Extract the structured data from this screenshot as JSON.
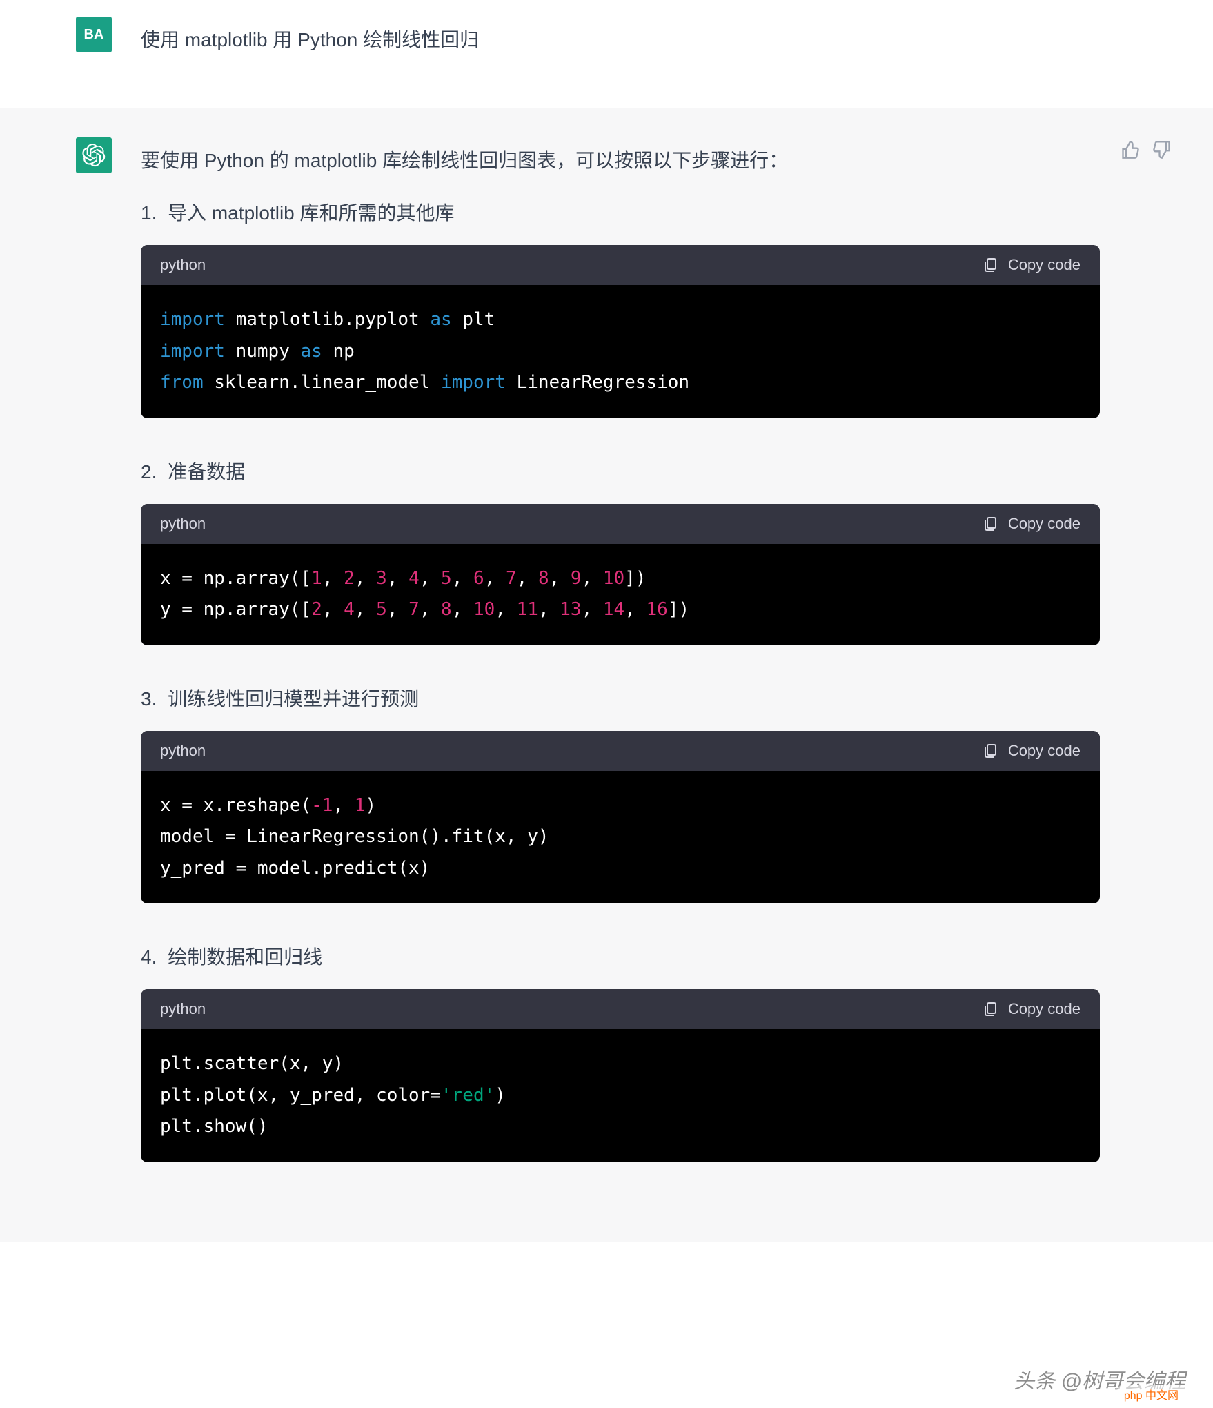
{
  "user": {
    "avatar_initials": "BA",
    "prompt": "使用 matplotlib 用 Python 绘制线性回归"
  },
  "assistant": {
    "intro": "要使用 Python 的 matplotlib 库绘制线性回归图表，可以按照以下步骤进行：",
    "steps": [
      {
        "label": "导入 matplotlib 库和所需的其他库"
      },
      {
        "label": "准备数据"
      },
      {
        "label": "训练线性回归模型并进行预测"
      },
      {
        "label": "绘制数据和回归线"
      }
    ]
  },
  "code_blocks": {
    "lang_label": "python",
    "copy_label": "Copy code",
    "block1_html": "<span class=\"tok-kw\">import</span> matplotlib.pyplot <span class=\"tok-kw\">as</span> plt\n<span class=\"tok-kw\">import</span> numpy <span class=\"tok-kw\">as</span> np\n<span class=\"tok-kw\">from</span> sklearn.linear_model <span class=\"tok-kw\">import</span> LinearRegression",
    "block2_html": "x = np.array([<span class=\"tok-num\">1</span>, <span class=\"tok-num\">2</span>, <span class=\"tok-num\">3</span>, <span class=\"tok-num\">4</span>, <span class=\"tok-num\">5</span>, <span class=\"tok-num\">6</span>, <span class=\"tok-num\">7</span>, <span class=\"tok-num\">8</span>, <span class=\"tok-num\">9</span>, <span class=\"tok-num\">10</span>])\ny = np.array([<span class=\"tok-num\">2</span>, <span class=\"tok-num\">4</span>, <span class=\"tok-num\">5</span>, <span class=\"tok-num\">7</span>, <span class=\"tok-num\">8</span>, <span class=\"tok-num\">10</span>, <span class=\"tok-num\">11</span>, <span class=\"tok-num\">13</span>, <span class=\"tok-num\">14</span>, <span class=\"tok-num\">16</span>])",
    "block3_html": "x = x.reshape(<span class=\"tok-num\">-1</span>, <span class=\"tok-num\">1</span>)\nmodel = LinearRegression().fit(x, y)\ny_pred = model.predict(x)",
    "block4_html": "plt.scatter(x, y)\nplt.plot(x, y_pred, color=<span class=\"tok-str\">'red'</span>)\nplt.show()"
  },
  "watermark": {
    "text": "头条 @树哥会编程",
    "badge": "php 中文网"
  }
}
